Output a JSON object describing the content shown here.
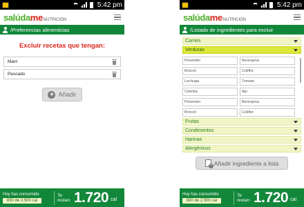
{
  "status_bar": {
    "time": "5:42 pm"
  },
  "app": {
    "logo_main": "salúda",
    "logo_accent": "me",
    "logo_sub": "NUTRICIÓN"
  },
  "left": {
    "breadcrumb": "/Preferencias alimenticias",
    "title": "Excluir recetas que tengan:",
    "items": [
      {
        "label": "Maní"
      },
      {
        "label": "Pescado"
      }
    ],
    "add_button": "Añadir"
  },
  "right": {
    "breadcrumb": "/Listado de ingredientes para excluir",
    "categories_top": [
      {
        "label": "Carnes",
        "active": false
      },
      {
        "label": "Verduras",
        "active": true
      }
    ],
    "ingredients": [
      "Pimentón",
      "Berenjena",
      "Brócoli",
      "Coliflor",
      "Lechuga",
      "Tomate",
      "Cebolla",
      "Ajo",
      "Pimentón",
      "Berenjena",
      "Brócoli",
      "Coliflor"
    ],
    "categories_bottom": [
      {
        "label": "Frutas"
      },
      {
        "label": "Condimentos"
      },
      {
        "label": "Harinas"
      },
      {
        "label": "Alergénicos"
      }
    ],
    "add_button": "Añadir ingrediente a lista"
  },
  "footer": {
    "consumed_label": "Hoy has consumido",
    "consumed_value": "830 de 2.500 cal",
    "remain_label_1": "Te",
    "remain_label_2": "restan",
    "remain_value": "1.720",
    "remain_unit": "cal"
  },
  "colors": {
    "brand_green": "#12873a",
    "accent_red": "#d9261c",
    "category_bg": "#f1f5c6",
    "category_active": "#dce83a"
  }
}
